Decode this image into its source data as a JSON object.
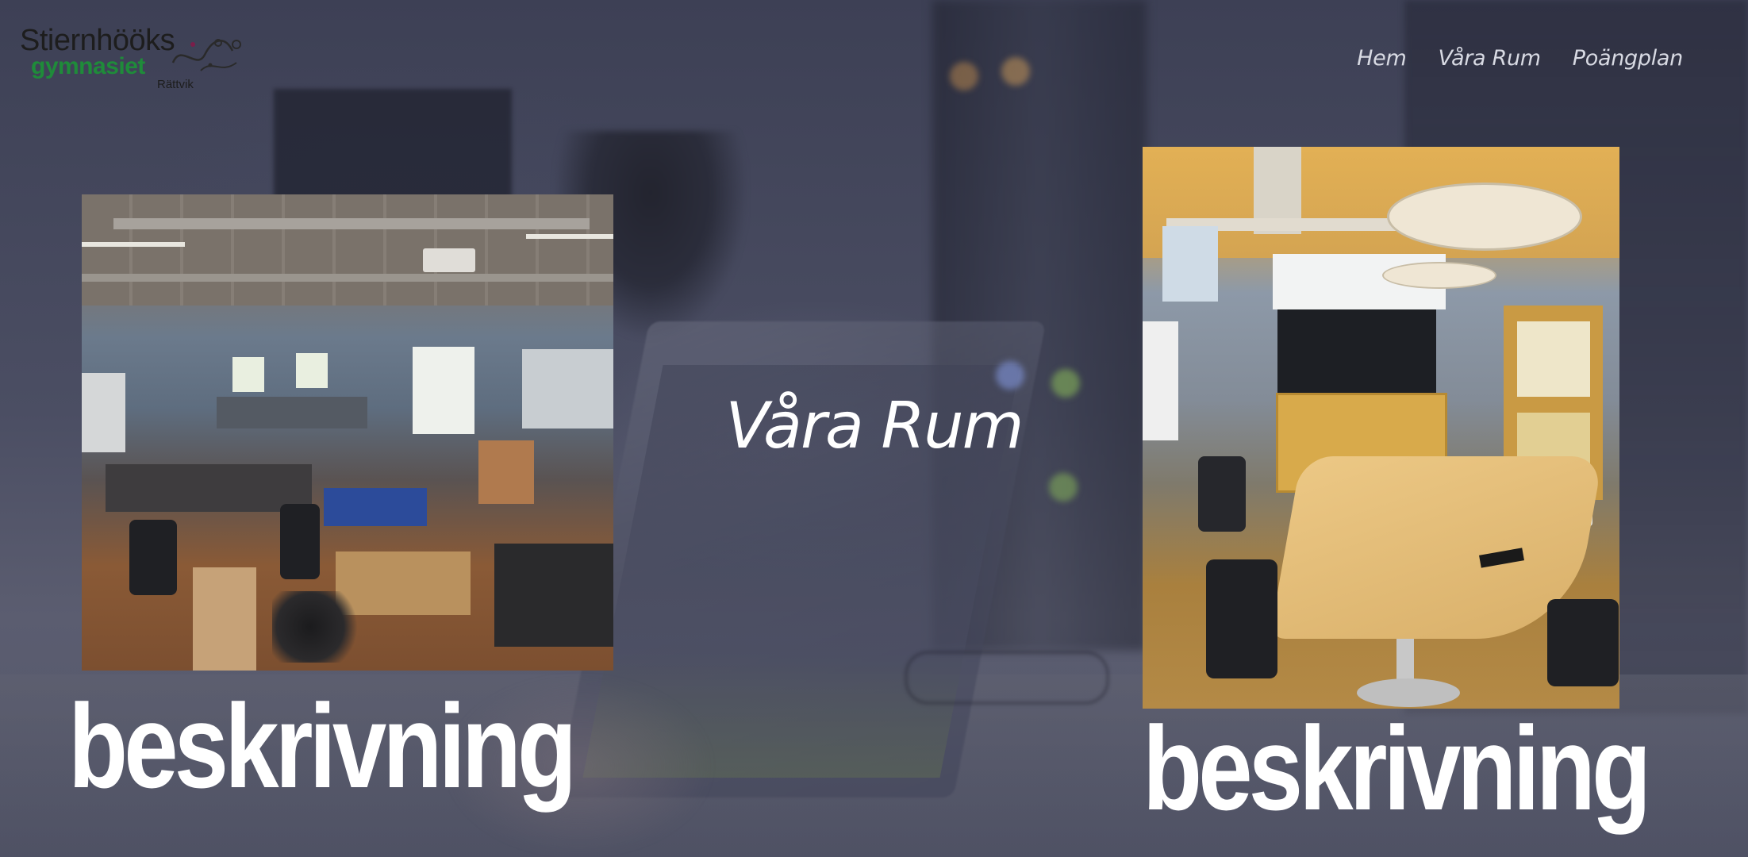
{
  "logo": {
    "line1": "Stiernhööks",
    "line2": "gymnasiet",
    "line3": "Rättvik"
  },
  "nav": {
    "items": [
      {
        "label": "Hem"
      },
      {
        "label": "Våra Rum"
      },
      {
        "label": "Poängplan"
      }
    ]
  },
  "main": {
    "title": "Våra Rum",
    "rooms": [
      {
        "photo": "lab-room-photo",
        "description": "beskrivning"
      },
      {
        "photo": "meeting-room-photo",
        "description": "beskrivning"
      }
    ]
  },
  "colors": {
    "logo_green": "#1f8b3a",
    "overlay": "#4b4e63",
    "text": "#ffffff",
    "nav_text": "#d8dae3"
  }
}
